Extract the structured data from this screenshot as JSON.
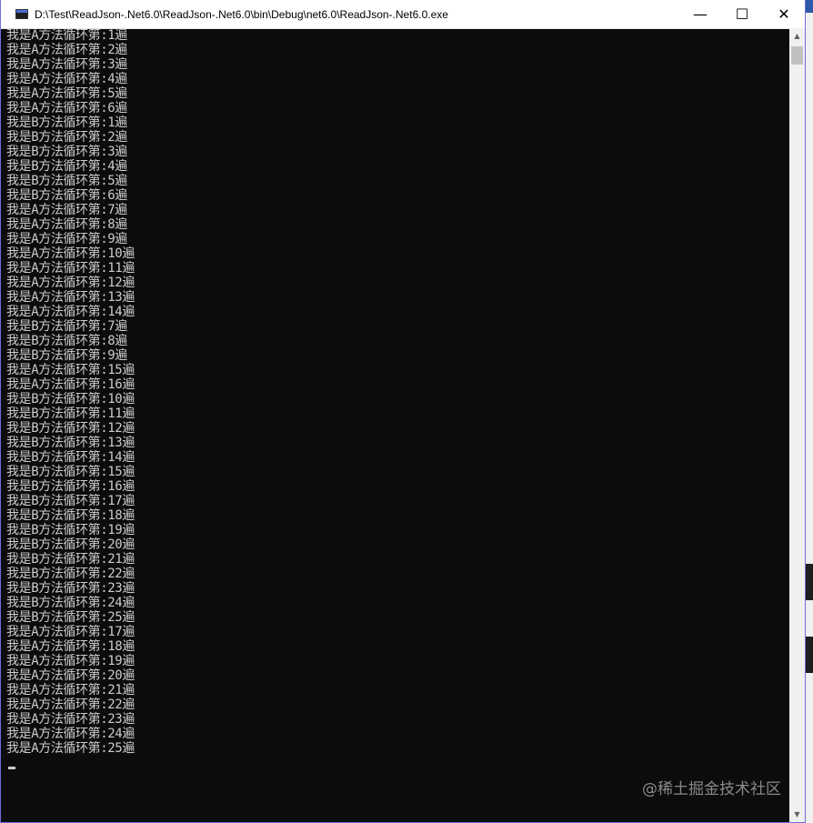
{
  "window": {
    "title": "D:\\Test\\ReadJson-.Net6.0\\ReadJson-.Net6.0\\bin\\Debug\\net6.0\\ReadJson-.Net6.0.exe",
    "app_icon": "console-icon",
    "minimize_glyph": "—",
    "maximize_glyph": "☐",
    "close_glyph": "✕"
  },
  "console": {
    "lines": [
      "我是A方法循环第:1遍",
      "我是A方法循环第:2遍",
      "我是A方法循环第:3遍",
      "我是A方法循环第:4遍",
      "我是A方法循环第:5遍",
      "我是A方法循环第:6遍",
      "我是B方法循环第:1遍",
      "我是B方法循环第:2遍",
      "我是B方法循环第:3遍",
      "我是B方法循环第:4遍",
      "我是B方法循环第:5遍",
      "我是B方法循环第:6遍",
      "我是A方法循环第:7遍",
      "我是A方法循环第:8遍",
      "我是A方法循环第:9遍",
      "我是A方法循环第:10遍",
      "我是A方法循环第:11遍",
      "我是A方法循环第:12遍",
      "我是A方法循环第:13遍",
      "我是A方法循环第:14遍",
      "我是B方法循环第:7遍",
      "我是B方法循环第:8遍",
      "我是B方法循环第:9遍",
      "我是A方法循环第:15遍",
      "我是A方法循环第:16遍",
      "我是B方法循环第:10遍",
      "我是B方法循环第:11遍",
      "我是B方法循环第:12遍",
      "我是B方法循环第:13遍",
      "我是B方法循环第:14遍",
      "我是B方法循环第:15遍",
      "我是B方法循环第:16遍",
      "我是B方法循环第:17遍",
      "我是B方法循环第:18遍",
      "我是B方法循环第:19遍",
      "我是B方法循环第:20遍",
      "我是B方法循环第:21遍",
      "我是B方法循环第:22遍",
      "我是B方法循环第:23遍",
      "我是B方法循环第:24遍",
      "我是B方法循环第:25遍",
      "我是A方法循环第:17遍",
      "我是A方法循环第:18遍",
      "我是A方法循环第:19遍",
      "我是A方法循环第:20遍",
      "我是A方法循环第:21遍",
      "我是A方法循环第:22遍",
      "我是A方法循环第:23遍",
      "我是A方法循环第:24遍",
      "我是A方法循环第:25遍"
    ]
  },
  "scrollbar": {
    "up_glyph": "▲",
    "down_glyph": "▼"
  },
  "watermark": "@稀土掘金技术社区"
}
